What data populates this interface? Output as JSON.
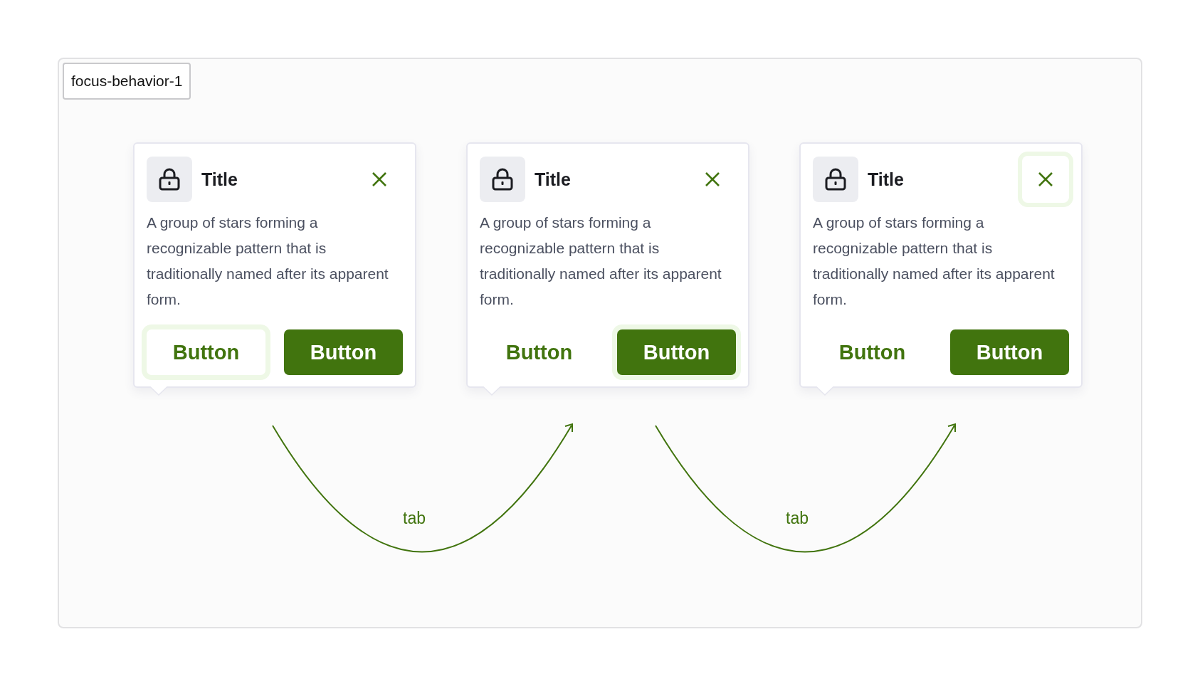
{
  "label": "focus-behavior-1",
  "popovers": [
    {
      "title": "Title",
      "body": "A group of stars forming a recognizable pattern that is traditionally named after its apparent form.",
      "close": {
        "focused": false
      },
      "buttons": [
        {
          "label": "Button",
          "kind": "secondary",
          "focused": true
        },
        {
          "label": "Button",
          "kind": "primary",
          "focused": false
        }
      ]
    },
    {
      "title": "Title",
      "body": "A group of stars forming a recognizable pattern that is traditionally named after its apparent form.",
      "close": {
        "focused": false
      },
      "buttons": [
        {
          "label": "Button",
          "kind": "secondary",
          "focused": false
        },
        {
          "label": "Button",
          "kind": "primary",
          "focused": true
        }
      ]
    },
    {
      "title": "Title",
      "body": "A group of stars forming a recognizable pattern that is traditionally named after its apparent form.",
      "close": {
        "focused": true
      },
      "buttons": [
        {
          "label": "Button",
          "kind": "secondary",
          "focused": false
        },
        {
          "label": "Button",
          "kind": "primary",
          "focused": false
        }
      ]
    }
  ],
  "transitions": [
    {
      "label": "tab"
    },
    {
      "label": "tab"
    }
  ]
}
